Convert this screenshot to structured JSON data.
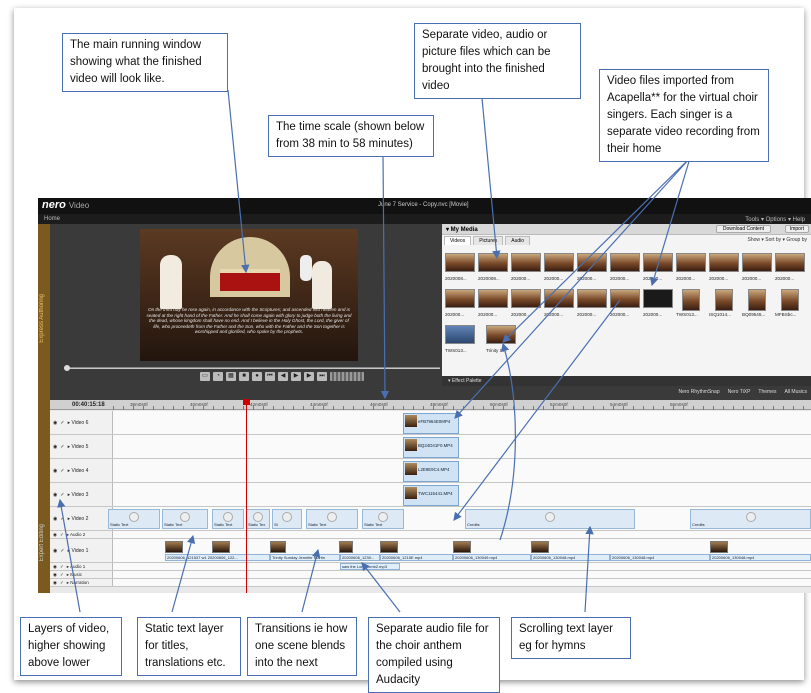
{
  "callouts": {
    "main_window": "The main running window showing what the finished video will look like.",
    "separate_files": "Separate video, audio or picture files which can be brought into the finished video",
    "acapella": "Video files imported from Acapella** for the virtual choir singers.  Each singer is a separate video recording from their home",
    "time_scale": "The time scale (shown below from 38 min to 58 minutes)",
    "layers": "Layers of video, higher showing above lower",
    "static_text": "Static text layer for titles, translations etc.",
    "transitions": "Transitions ie how one scene blends into the next",
    "audio_file": "Separate audio file for the choir anthem compiled using Audacity",
    "scrolling_text": "Scrolling text layer eg for hymns"
  },
  "app": {
    "logo": "nero",
    "logo_sub": "Video",
    "window_title": "June 7 Service - Copy.nvc [Movie]",
    "home": "Home",
    "menu_right": "Tools ▾   Options ▾   Help",
    "sidebar_label": "Expert Editing",
    "sidebar_top": "Express Authoring"
  },
  "preview": {
    "overlay_text": "On the third day he rose again, in accordance with the Scriptures; and ascended into heaven and is seated at the right hand of the Father. And he shall come again with glory to judge both the living and the dead, whose kingdom shall have no end. And I believe in the Holy Ghost, the Lord, the giver of life, who proceedeth from the Father and the Son, who with the Father and the Son together is worshipped and glorified, who spoke by the prophets."
  },
  "media": {
    "header": "▾ My Media",
    "download": "Download Content",
    "import": "Import",
    "tabs": [
      "Videos",
      "Pictures",
      "Audio"
    ],
    "options": "Show ▾  Sort by ▾  Group by",
    "row1": [
      "2020008...",
      "2020008...",
      "202000...",
      "202000...",
      "202000...",
      "202000...",
      "202000...",
      "202000...",
      "202000...",
      "202000...",
      "202000..."
    ],
    "row2": [
      "202000...",
      "202000...",
      "202000...",
      "202000...",
      "202000...",
      "202000...",
      "202000...",
      "TWS013...",
      "ISQ1014...",
      "BQ09545...",
      "MFBSbc..."
    ],
    "row3": [
      "TWS013...",
      "Trinity S..."
    ]
  },
  "effect_palette": "▾ Effect Palette",
  "timeline_tools": [
    "Nero RhythmSnap",
    "Nero TiXP",
    "Themes",
    "All Musics"
  ],
  "timeline": {
    "timecode": "00:40:15:18",
    "marks": [
      "38m0s0f",
      "40m0s0f",
      "42m0s0f",
      "44m0s0f",
      "46m0s0f",
      "48m0s0f",
      "50m0s0f",
      "52m0s0f",
      "54m0s0f",
      "56m0s0f"
    ],
    "tracks": [
      "Video 6",
      "Video 5",
      "Video 4",
      "Video 3",
      "Video 2",
      "Audio 2",
      "Video 1",
      "Audio 1",
      "Music",
      "Narration"
    ],
    "acapella_clips": [
      "eFB7964E0MP4",
      "BQ24D41F0.MP4",
      "L2E9E9C4.MP4",
      "TWC115441.MP4"
    ],
    "static_texts": [
      "Static Text",
      "Static Text",
      "Static Text",
      "Static Tex",
      "St",
      "Static Text",
      "Static Text"
    ],
    "credits": [
      "Credits",
      "Credits"
    ],
    "audio_labels": [
      "20200606_121537 w1 20200606_122...",
      "Trinity Sunday Jennifer Martin",
      "20200606_1230...",
      "20200606_1215E.mp4",
      "20200606_130049.mp4",
      "20200606_130048.mp4",
      "20200606_130048.mp4",
      "20200606_130048.mp4",
      "saw the Lord comb2.mp3"
    ]
  }
}
